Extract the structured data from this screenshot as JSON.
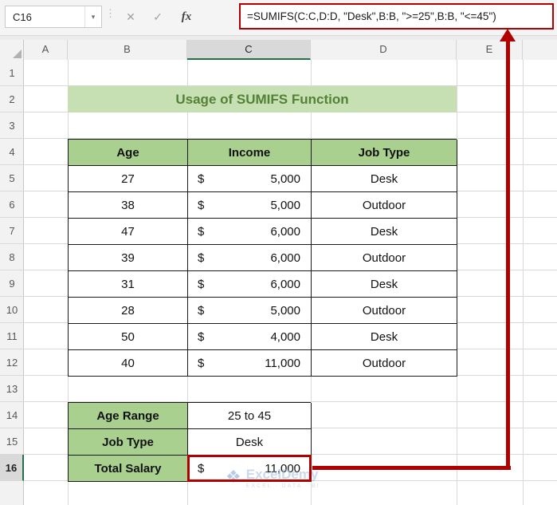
{
  "formula_bar": {
    "name_box": "C16",
    "dropdown_icon": "▾",
    "handle_icon": "⋮",
    "cancel_label": "✕",
    "enter_label": "✓",
    "fx_label": "fx",
    "formula": "=SUMIFS(C:C,D:D, \"Desk\",B:B, \">=25\",B:B, \"<=45\")"
  },
  "grid": {
    "columns": [
      "A",
      "B",
      "C",
      "D",
      "E"
    ],
    "rows": [
      "1",
      "2",
      "3",
      "4",
      "5",
      "6",
      "7",
      "8",
      "9",
      "10",
      "11",
      "12",
      "13",
      "14",
      "15",
      "16"
    ],
    "selected_column": "C",
    "selected_row": "16",
    "active_cell": "C16"
  },
  "banner_title": "Usage of SUMIFS Function",
  "currency_symbol": "$",
  "table": {
    "headers": [
      "Age",
      "Income",
      "Job Type"
    ],
    "rows": [
      {
        "age": "27",
        "income": "5,000",
        "job": "Desk"
      },
      {
        "age": "38",
        "income": "5,000",
        "job": "Outdoor"
      },
      {
        "age": "47",
        "income": "6,000",
        "job": "Desk"
      },
      {
        "age": "39",
        "income": "6,000",
        "job": "Outdoor"
      },
      {
        "age": "31",
        "income": "6,000",
        "job": "Desk"
      },
      {
        "age": "28",
        "income": "5,000",
        "job": "Outdoor"
      },
      {
        "age": "50",
        "income": "4,000",
        "job": "Desk"
      },
      {
        "age": "40",
        "income": "11,000",
        "job": "Outdoor"
      }
    ]
  },
  "summary": {
    "rows": [
      {
        "label": "Age Range",
        "value": "25 to 45"
      },
      {
        "label": "Job Type",
        "value": "Desk"
      },
      {
        "label": "Total Salary",
        "value": "11,000"
      }
    ]
  },
  "watermark": {
    "icon": "❖",
    "name": "ExcelDemy",
    "tagline": "EXCEL · DATA · BI"
  },
  "colors": {
    "header_green": "#A9D08E",
    "banner_green": "#C6E0B4",
    "banner_text_green": "#538135",
    "selection_green": "#217346",
    "annotation_red": "#B00000"
  }
}
